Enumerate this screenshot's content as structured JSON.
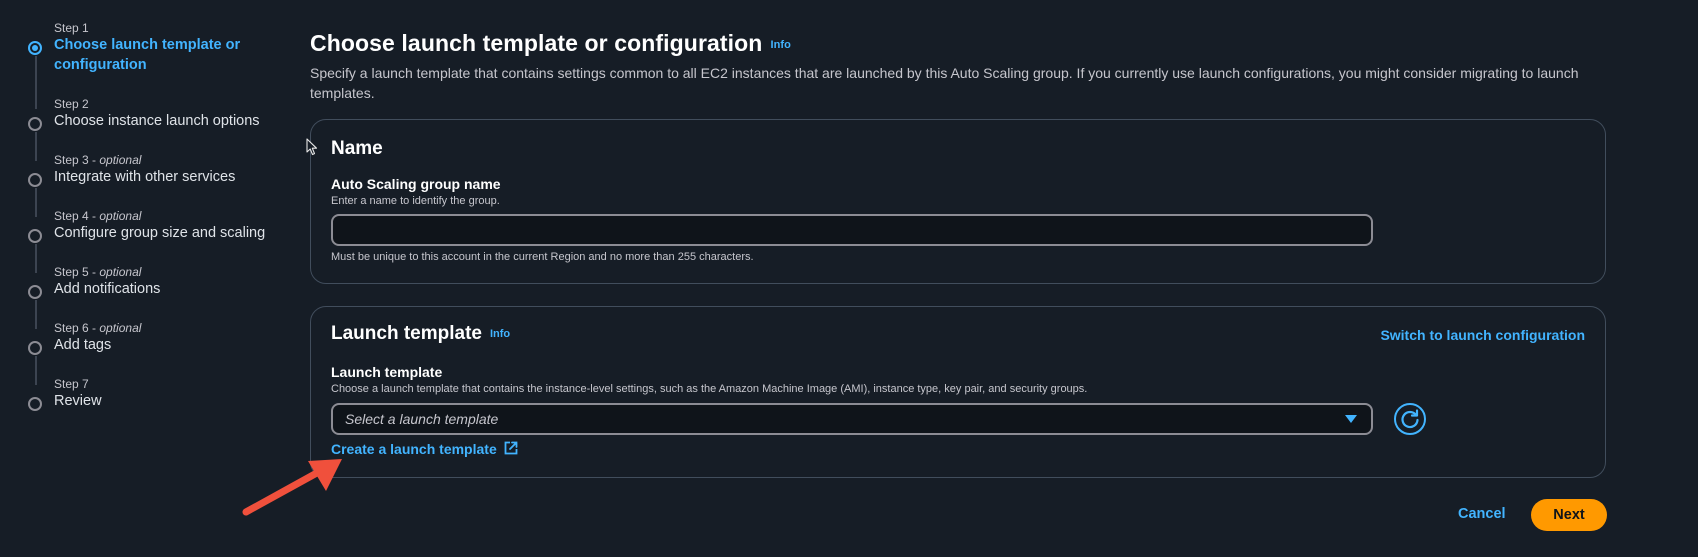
{
  "wizard": {
    "steps": [
      {
        "num": "Step 1",
        "optional": "",
        "title": "Choose launch template or configuration"
      },
      {
        "num": "Step 2",
        "optional": "",
        "title": "Choose instance launch options"
      },
      {
        "num": "Step 3",
        "optional": "optional",
        "title": "Integrate with other services"
      },
      {
        "num": "Step 4",
        "optional": "optional",
        "title": "Configure group size and scaling"
      },
      {
        "num": "Step 5",
        "optional": "optional",
        "title": "Add notifications"
      },
      {
        "num": "Step 6",
        "optional": "optional",
        "title": "Add tags"
      },
      {
        "num": "Step 7",
        "optional": "",
        "title": "Review"
      }
    ],
    "optional_separator": " - "
  },
  "page": {
    "title": "Choose launch template or configuration",
    "info": "Info",
    "description": "Specify a launch template that contains settings common to all EC2 instances that are launched by this Auto Scaling group. If you currently use launch configurations, you might consider migrating to launch templates."
  },
  "name_panel": {
    "title": "Name",
    "field_label": "Auto Scaling group name",
    "field_desc": "Enter a name to identify the group.",
    "field_value": "",
    "field_constraint": "Must be unique to this account in the current Region and no more than 255 characters."
  },
  "template_panel": {
    "title": "Launch template",
    "info": "Info",
    "switch_link": "Switch to launch configuration",
    "field_label": "Launch template",
    "field_desc": "Choose a launch template that contains the instance-level settings, such as the Amazon Machine Image (AMI), instance type, key pair, and security groups.",
    "select_placeholder": "Select a launch template",
    "create_link": "Create a launch template"
  },
  "footer": {
    "cancel": "Cancel",
    "next": "Next"
  },
  "colors": {
    "accent": "#42b4ff",
    "primary_button": "#ff9900",
    "background": "#161d26",
    "annotation_arrow": "#f0503c"
  }
}
